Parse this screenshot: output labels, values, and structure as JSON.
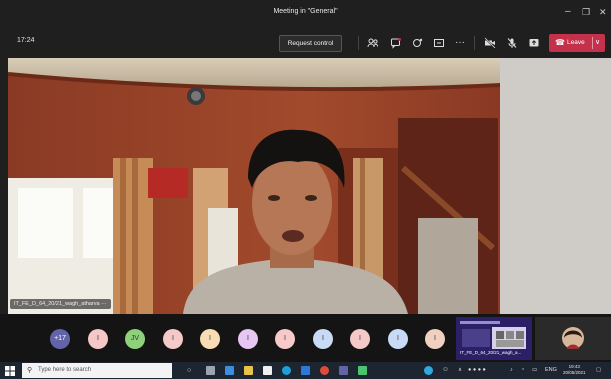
{
  "window": {
    "title": "Meeting in \"General\"",
    "minimize_icon": "–",
    "maximize_icon": "❐",
    "close_icon": "✕"
  },
  "toolbar": {
    "timer": "17:24",
    "request_control_label": "Request control",
    "leave_label": "Leave",
    "icons": [
      "participants-icon",
      "chat-icon",
      "reactions-icon",
      "share-tray-icon",
      "more-options-icon",
      "camera-off-icon",
      "mic-off-icon",
      "share-icon"
    ]
  },
  "video": {
    "participant_label": "IT_FE_D_64_20/21_wagh_atharva  ···"
  },
  "participants": {
    "overflow_count": "+17",
    "avatars": [
      {
        "initial": "I",
        "color": "#f5c7c7"
      },
      {
        "initial": "JV",
        "color": "#8fd17a"
      },
      {
        "initial": "I",
        "color": "#f6c9c9"
      },
      {
        "initial": "I",
        "color": "#f8dcb3"
      },
      {
        "initial": "I",
        "color": "#e6c6f2"
      },
      {
        "initial": "I",
        "color": "#f7c9c9"
      },
      {
        "initial": "I",
        "color": "#c8daf4"
      },
      {
        "initial": "I",
        "color": "#f6c9c9"
      },
      {
        "initial": "I",
        "color": "#c9daf6"
      },
      {
        "initial": "I",
        "color": "#f0d0c0"
      }
    ],
    "thumbnail_label": "IT_FE_D_64_20/21_wagh_a..."
  },
  "taskbar": {
    "search_placeholder": "Type here to search",
    "tray_language": "ENG",
    "clock_time": "19:43",
    "clock_date": "20/05/2021"
  },
  "colors": {
    "leave": "#c4314b",
    "overflow_avatar": "#6264a7",
    "taskbar": "#1c2530"
  }
}
